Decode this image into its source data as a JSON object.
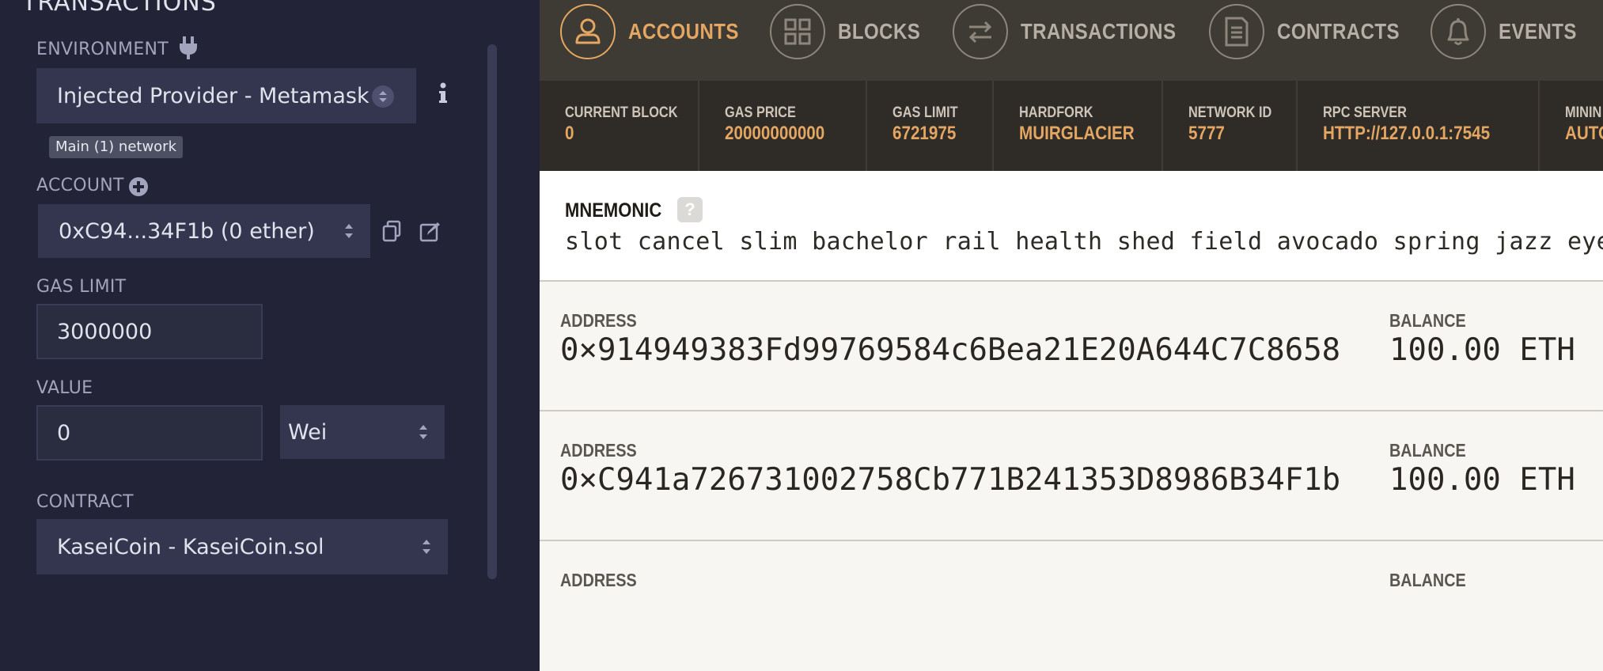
{
  "remix": {
    "section_title": "TRANSACTIONS",
    "environment": {
      "label": "ENVIRONMENT",
      "value": "Injected Provider - Metamask",
      "network_badge": "Main (1) network"
    },
    "account": {
      "label": "ACCOUNT",
      "value": "0xC94...34F1b (0 ether)"
    },
    "gas_limit": {
      "label": "GAS LIMIT",
      "value": "3000000"
    },
    "value": {
      "label": "VALUE",
      "amount": "0",
      "unit": "Wei"
    },
    "contract": {
      "label": "CONTRACT",
      "value": "KaseiCoin - KaseiCoin.sol"
    }
  },
  "ganache": {
    "nav": [
      {
        "label": "ACCOUNTS",
        "icon": "user-icon",
        "active": true
      },
      {
        "label": "BLOCKS",
        "icon": "blocks-grid-icon",
        "active": false
      },
      {
        "label": "TRANSACTIONS",
        "icon": "transfer-arrows-icon",
        "active": false
      },
      {
        "label": "CONTRACTS",
        "icon": "document-icon",
        "active": false
      },
      {
        "label": "EVENTS",
        "icon": "bell-icon",
        "active": false
      }
    ],
    "stats": [
      {
        "label": "CURRENT BLOCK",
        "value": "0"
      },
      {
        "label": "GAS PRICE",
        "value": "20000000000"
      },
      {
        "label": "GAS LIMIT",
        "value": "6721975"
      },
      {
        "label": "HARDFORK",
        "value": "MUIRGLACIER"
      },
      {
        "label": "NETWORK ID",
        "value": "5777"
      },
      {
        "label": "RPC SERVER",
        "value": "HTTP://127.0.0.1:7545"
      },
      {
        "label": "MININ",
        "value": "AUTO"
      }
    ],
    "mnemonic": {
      "title": "MNEMONIC",
      "help": "?",
      "words": "slot cancel slim bachelor rail health shed field avocado spring jazz eyebrow"
    },
    "accounts": [
      {
        "address_label": "ADDRESS",
        "address": "0×914949383Fd99769584c6Bea21E20A644C7C8658",
        "balance_label": "BALANCE",
        "balance": "100.00 ETH"
      },
      {
        "address_label": "ADDRESS",
        "address": "0×C941a726731002758Cb771B241353D8986B34F1b",
        "balance_label": "BALANCE",
        "balance": "100.00 ETH"
      },
      {
        "address_label": "ADDRESS",
        "address": "",
        "balance_label": "BALANCE",
        "balance": ""
      }
    ]
  },
  "colors": {
    "accent": "#e4a663",
    "ganache_nav": "#3e3a34",
    "remix_bg": "#222336"
  }
}
